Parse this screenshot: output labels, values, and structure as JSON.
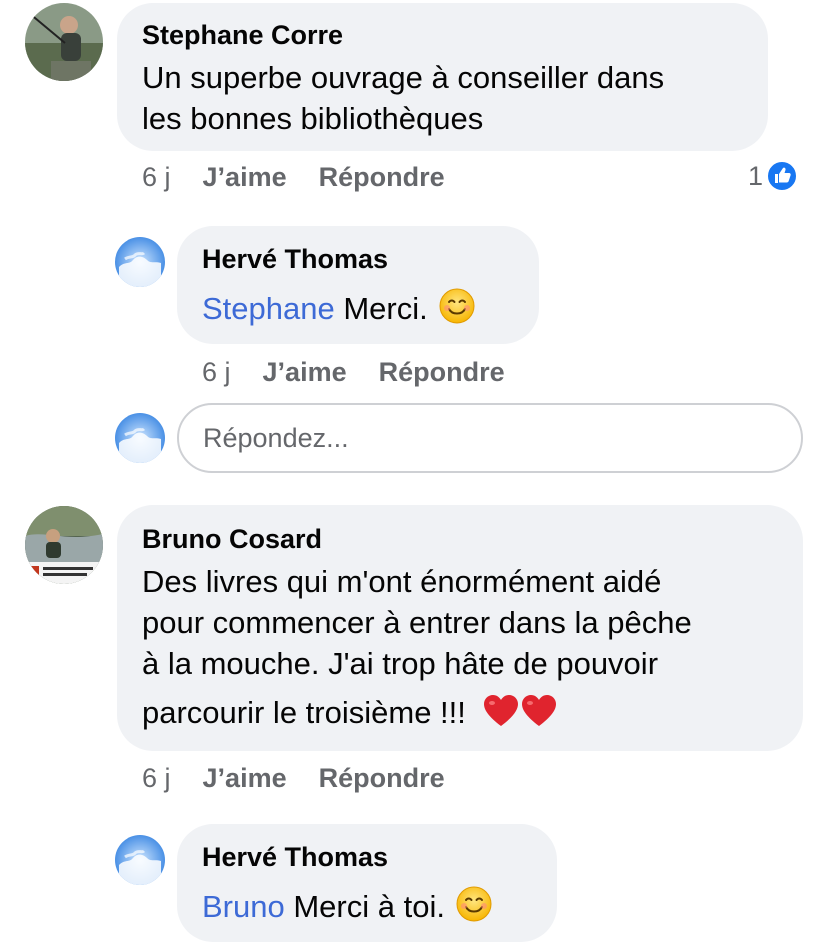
{
  "comments": [
    {
      "author": "Stephane Corre",
      "lines": [
        "Un superbe ouvrage à conseiller dans",
        "les bonnes bibliothèques"
      ],
      "time": "6 j",
      "like_label": "J’aime",
      "reply_label": "Répondre",
      "like_count": "1"
    },
    {
      "author": "Hervé Thomas",
      "mention": "Stephane",
      "text": " Merci.",
      "time": "6 j",
      "like_label": "J’aime",
      "reply_label": "Répondre"
    },
    {
      "author": "Bruno Cosard",
      "lines": [
        "Des livres qui m'ont énormément aidé",
        "pour commencer à entrer dans la pêche",
        "à la mouche. J'ai trop hâte de pouvoir",
        "parcourir le troisième !!!"
      ],
      "time": "6 j",
      "like_label": "J’aime",
      "reply_label": "Répondre"
    },
    {
      "author": "Hervé Thomas",
      "mention": "Bruno",
      "text": " Merci à toi.",
      "time": "",
      "like_label": "",
      "reply_label": ""
    }
  ],
  "reply_box": {
    "placeholder": "Répondez..."
  },
  "icons": {
    "like": "thumbs-up-icon",
    "smile": "smiling-face-emoji",
    "heart": "red-heart-emoji"
  },
  "colors": {
    "mention": "#3d6ad6",
    "like_blue": "#1877f2",
    "bubble": "#f0f2f5",
    "heart": "#e0242e"
  }
}
